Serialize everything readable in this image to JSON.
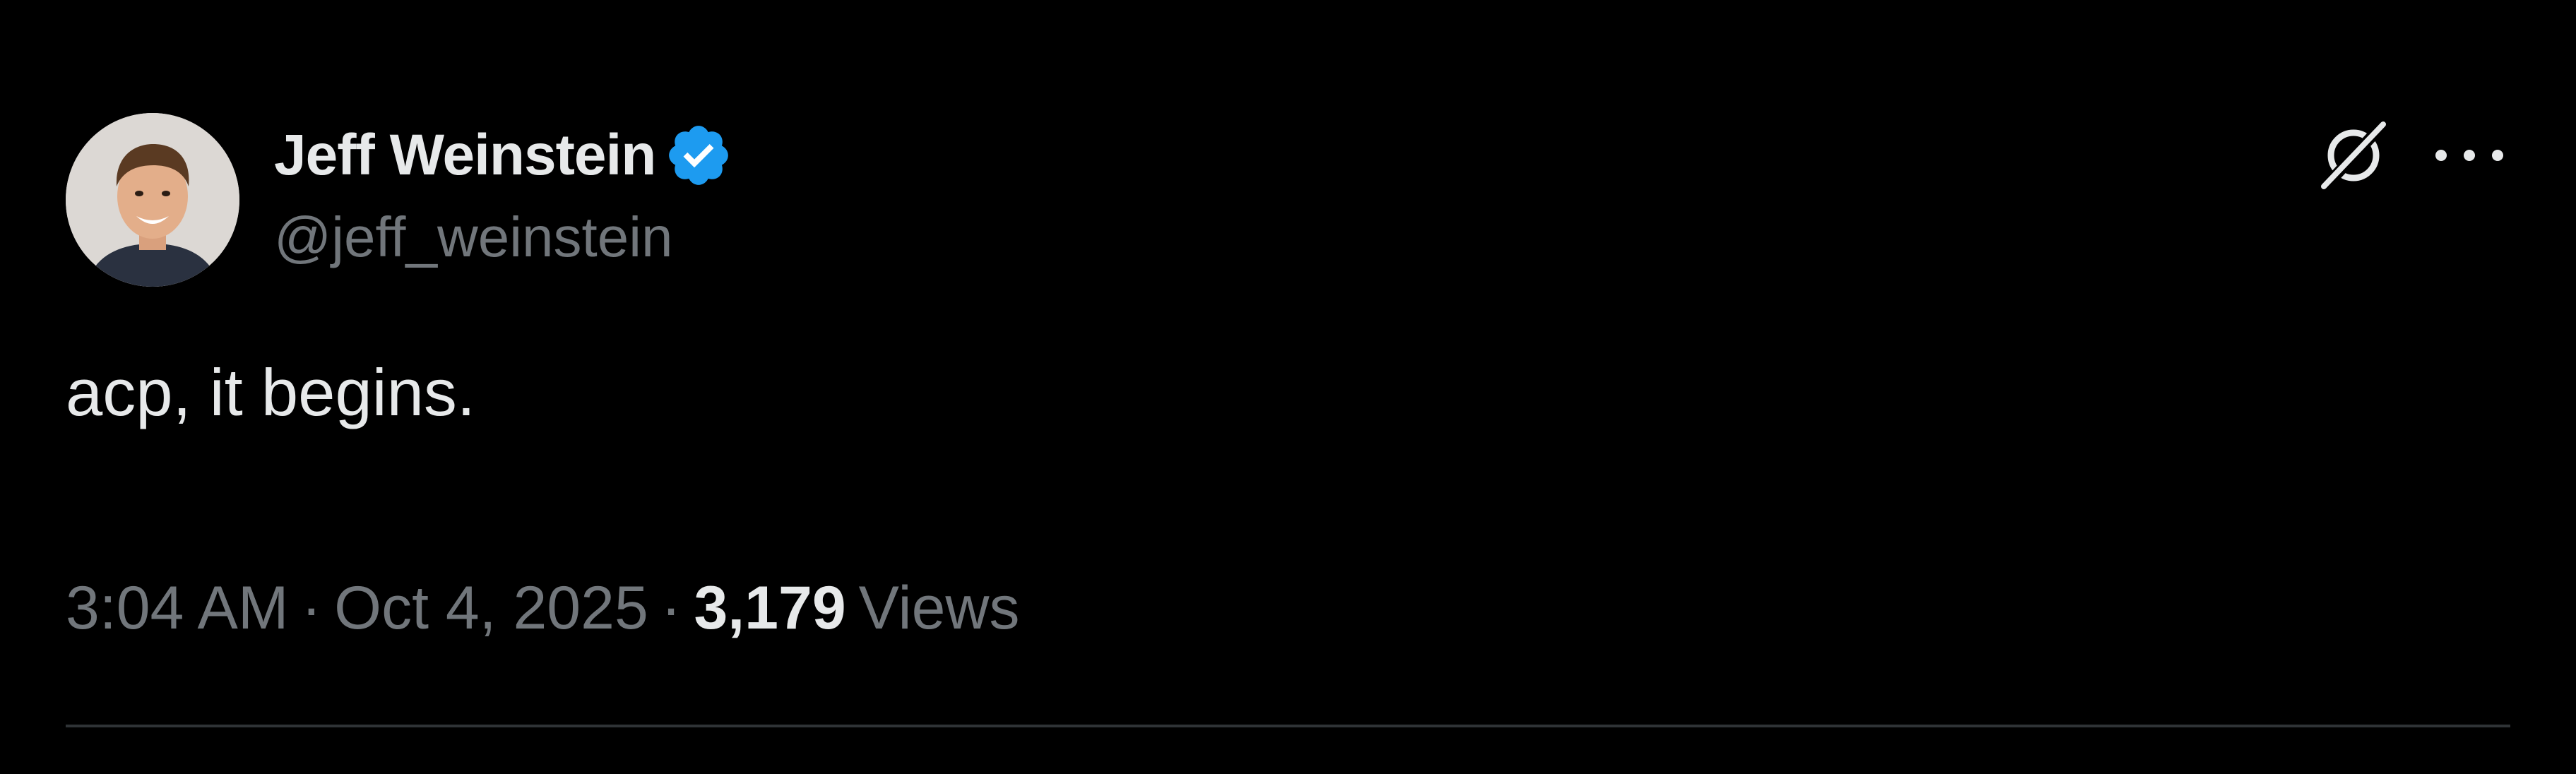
{
  "author": {
    "display_name": "Jeff Weinstein",
    "handle": "@jeff_weinstein",
    "verified": true
  },
  "tweet": {
    "text": "acp, it begins."
  },
  "meta": {
    "time": "3:04 AM",
    "separator": "·",
    "date": "Oct 4, 2025",
    "views_count": "3,179",
    "views_label": "Views"
  },
  "icons": {
    "avatar": "profile-photo",
    "verified": "verified-badge-icon",
    "grok": "grok-icon",
    "more": "more-options-icon"
  },
  "colors": {
    "background": "#000000",
    "primary_text": "#e7e9ea",
    "secondary_text": "#71767b",
    "verified_blue": "#1d9bf0",
    "divider": "#2f3336"
  }
}
